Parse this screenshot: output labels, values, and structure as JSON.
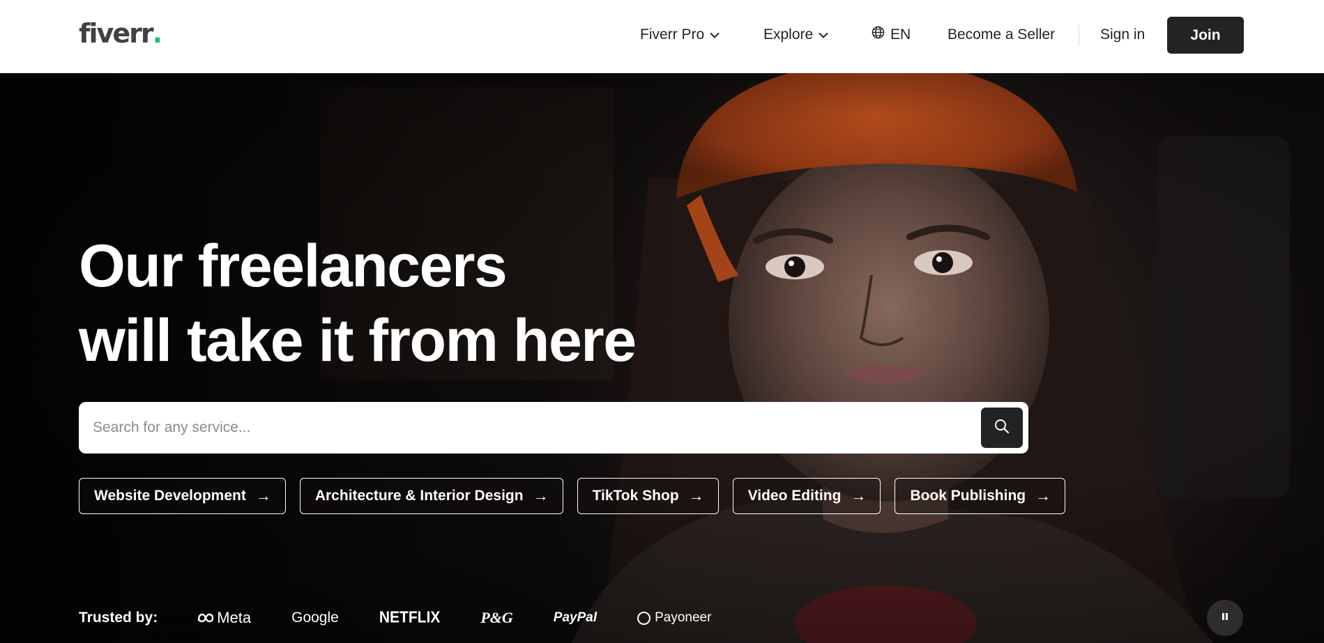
{
  "header": {
    "logo_text": "fiverr",
    "logo_dot": ".",
    "nav": {
      "fiverr_pro": "Fiverr Pro",
      "explore": "Explore",
      "language": "EN",
      "become_seller": "Become a Seller",
      "sign_in": "Sign in",
      "join": "Join"
    }
  },
  "hero": {
    "title_line1": "Our freelancers",
    "title_line2": "will take it from here",
    "search": {
      "placeholder": "Search for any service...",
      "value": ""
    },
    "chips": [
      {
        "label": "Website Development"
      },
      {
        "label": "Architecture & Interior Design"
      },
      {
        "label": "TikTok Shop"
      },
      {
        "label": "Video Editing"
      },
      {
        "label": "Book Publishing"
      }
    ],
    "trusted_by": {
      "label": "Trusted by:",
      "brands": [
        "Meta",
        "Google",
        "NETFLIX",
        "P&G",
        "PayPal",
        "Payoneer"
      ]
    }
  },
  "colors": {
    "brand_green": "#1dbf73",
    "dark": "#222325",
    "logo_gray": "#404145"
  },
  "icons": {
    "dropdown": "chevron-down-icon",
    "language": "globe-icon",
    "search": "search-icon",
    "pause": "pause-icon",
    "chip_arrow": "arrow-right-icon"
  }
}
